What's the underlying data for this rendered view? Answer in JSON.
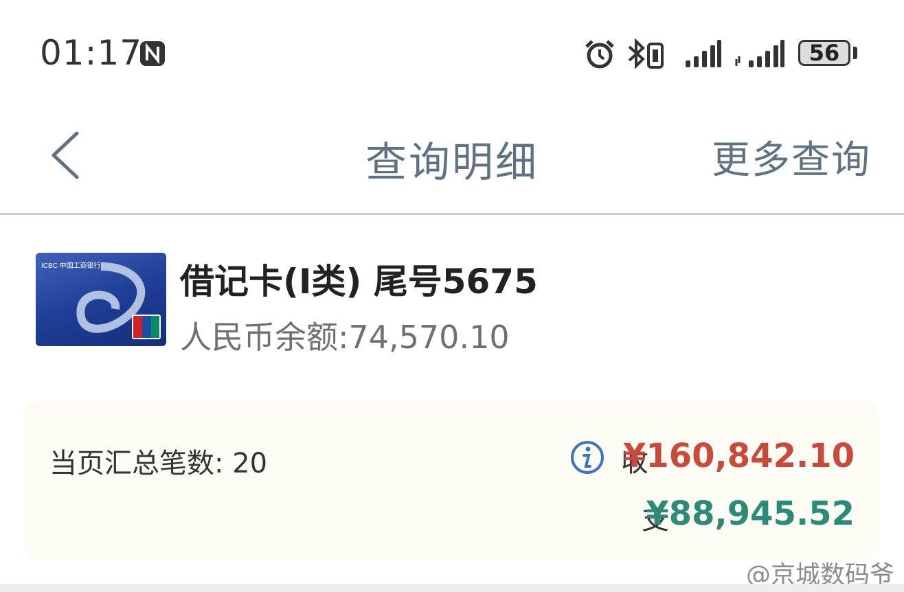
{
  "status_bar": {
    "time": "01:17",
    "battery_level": "56",
    "icons": [
      "nfc-icon",
      "alarm-icon",
      "bluetooth-vibrate-icon",
      "signal-icon",
      "signal-icon"
    ]
  },
  "nav": {
    "title": "查询明细",
    "more_label": "更多查询",
    "back_icon": "chevron-left-icon"
  },
  "card": {
    "title": "借记卡(I类)  尾号5675",
    "balance": "人民币余额:74,570.10",
    "card_logo_text": "ICBC 中国工商银行"
  },
  "summary": {
    "count_label": "当页汇总笔数: 20",
    "income_label": "收",
    "income_value": "¥160,842.10",
    "expense_label": "支",
    "expense_value": "¥88,945.52"
  },
  "watermark": "@京城数码爷",
  "colors": {
    "accent_text": "#5e7382",
    "income": "#c84a3c",
    "expense": "#2d8a77",
    "info_icon": "#3a73c5"
  }
}
